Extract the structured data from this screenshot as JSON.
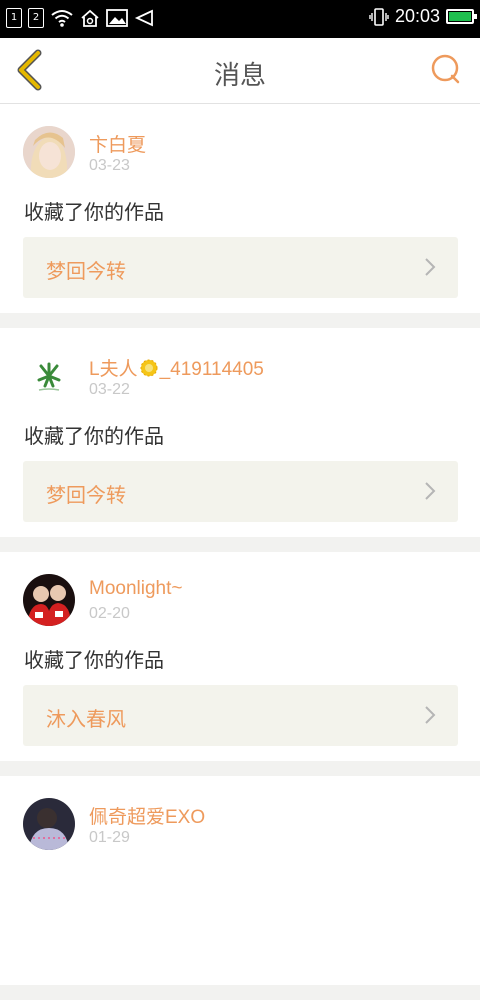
{
  "status_bar": {
    "sim1": "1",
    "sim2": "2",
    "time": "20:03",
    "battery_level": 1.0
  },
  "nav": {
    "title": "消息"
  },
  "messages": [
    {
      "user": "卞白夏",
      "date": "03-23",
      "text": "收藏了你的作品",
      "work": "梦回今转"
    },
    {
      "user_prefix": "L夫人",
      "user_suffix": "_419114405",
      "date": "03-22",
      "text": "收藏了你的作品",
      "work": "梦回今转"
    },
    {
      "user": "Moonlight~",
      "date": "02-20",
      "text": "收藏了你的作品",
      "work": "沐入春风"
    },
    {
      "user": "佩奇超爱EXO",
      "date": "01-29"
    }
  ],
  "colors": {
    "accent": "#ee9a5c",
    "back_arrow": "#e5b800",
    "link_bg": "#f3f3ec"
  }
}
